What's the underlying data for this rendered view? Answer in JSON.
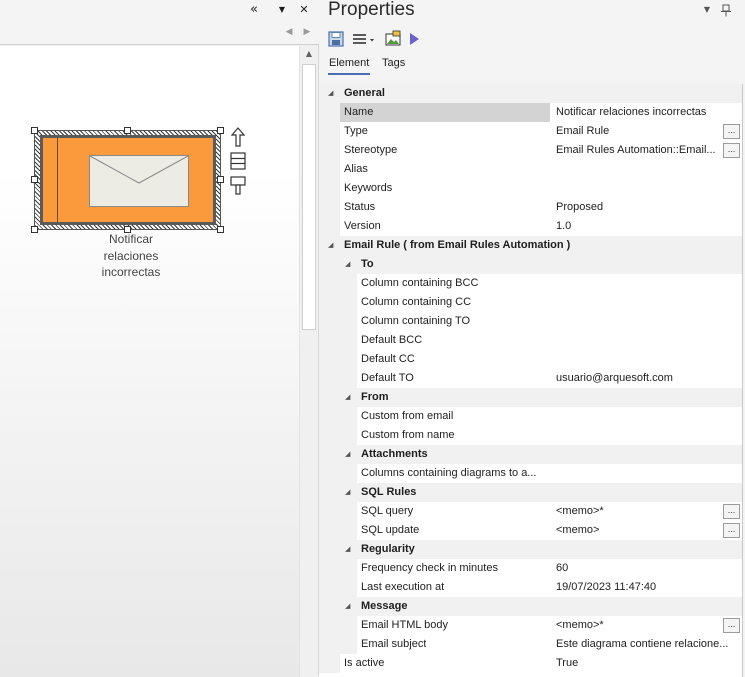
{
  "left_panel": {
    "collapse_icon": "«",
    "dropdown_icon": "▼",
    "close_icon": "✕",
    "nav_prev_icon": "◀",
    "nav_next_icon": "▶",
    "element_label": "Notificar relaciones incorrectas",
    "element_color": "#fb9a3c",
    "scroll_up_icon": "▲"
  },
  "properties": {
    "title": "Properties",
    "title_dropdown_icon": "▼",
    "pin_icon": "📌",
    "tabs": [
      {
        "label": "Element"
      },
      {
        "label": "Tags"
      }
    ],
    "ellipsis_label": "...",
    "general": {
      "label": "General",
      "rows": [
        {
          "name": "Name",
          "value": "Notificar relaciones incorrectas"
        },
        {
          "name": "Type",
          "value": "Email Rule"
        },
        {
          "name": "Stereotype",
          "value": "Email Rules Automation::Email..."
        },
        {
          "name": "Alias",
          "value": ""
        },
        {
          "name": "Keywords",
          "value": ""
        },
        {
          "name": "Status",
          "value": "Proposed"
        },
        {
          "name": "Version",
          "value": "1.0"
        }
      ]
    },
    "email_rule": {
      "label": "Email Rule  ( from Email Rules Automation )",
      "to": {
        "label": "To",
        "rows": [
          {
            "name": "Column containing BCC",
            "value": ""
          },
          {
            "name": "Column containing CC",
            "value": ""
          },
          {
            "name": "Column containing TO",
            "value": ""
          },
          {
            "name": "Default BCC",
            "value": ""
          },
          {
            "name": "Default CC",
            "value": ""
          },
          {
            "name": "Default TO",
            "value": "usuario@arquesoft.com"
          }
        ]
      },
      "from": {
        "label": "From",
        "rows": [
          {
            "name": "Custom from email",
            "value": ""
          },
          {
            "name": "Custom from name",
            "value": ""
          }
        ]
      },
      "attachments": {
        "label": "Attachments",
        "rows": [
          {
            "name": "Columns containing diagrams to a...",
            "value": ""
          }
        ]
      },
      "sql_rules": {
        "label": "SQL Rules",
        "rows": [
          {
            "name": "SQL query",
            "value": "<memo>*"
          },
          {
            "name": "SQL update",
            "value": "<memo>"
          }
        ]
      },
      "regularity": {
        "label": "Regularity",
        "rows": [
          {
            "name": "Frequency check in minutes",
            "value": "60"
          },
          {
            "name": "Last execution at",
            "value": "19/07/2023 11:47:40"
          }
        ]
      },
      "message": {
        "label": "Message",
        "rows": [
          {
            "name": "Email HTML body",
            "value": "<memo>*"
          },
          {
            "name": "Email subject",
            "value": "Este diagrama contiene relacione..."
          }
        ]
      },
      "is_active": {
        "name": "Is active",
        "value": "True"
      }
    }
  }
}
